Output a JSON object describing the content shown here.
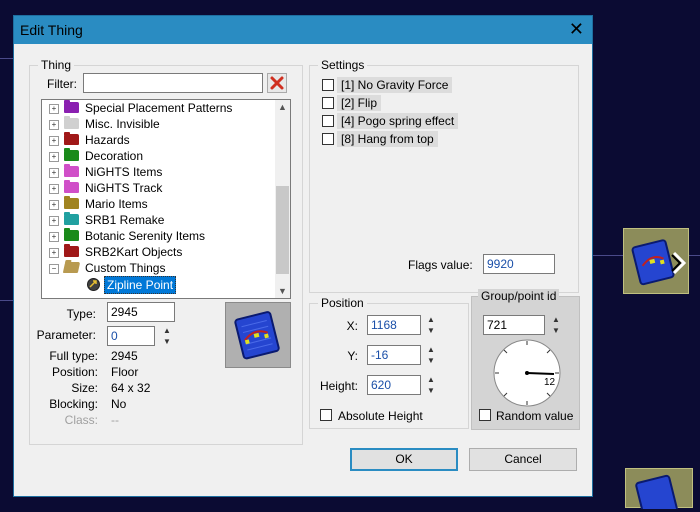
{
  "dialog": {
    "title": "Edit Thing",
    "close_symbol": "✕"
  },
  "thing": {
    "group_label": "Thing",
    "filter_label": "Filter:",
    "filter_value": "",
    "tree": [
      {
        "label": "Special Placement Patterns",
        "color": "#8a1fb0"
      },
      {
        "label": "Misc. Invisible",
        "color": "#d0d0d0"
      },
      {
        "label": "Hazards",
        "color": "#a01818"
      },
      {
        "label": "Decoration",
        "color": "#1a8a1a"
      },
      {
        "label": "NiGHTS Items",
        "color": "#d04fc8"
      },
      {
        "label": "NiGHTS Track",
        "color": "#d04fc8"
      },
      {
        "label": "Mario Items",
        "color": "#a08420"
      },
      {
        "label": "SRB1 Remake",
        "color": "#20a0a0"
      },
      {
        "label": "Botanic Serenity Items",
        "color": "#1a8a1a"
      },
      {
        "label": "SRB2Kart Objects",
        "color": "#a01818"
      },
      {
        "label": "Custom Things",
        "color": "#b89a50"
      },
      {
        "label": "Zipline Point",
        "color": "#2a8cc2"
      }
    ],
    "type_label": "Type:",
    "type_value": "2945",
    "parameter_label": "Parameter:",
    "parameter_value": "0",
    "fulltype_label": "Full type:",
    "fulltype_value": "2945",
    "position_label": "Position:",
    "position_value": "Floor",
    "size_label": "Size:",
    "size_value": "64 x 32",
    "blocking_label": "Blocking:",
    "blocking_value": "No",
    "class_label": "Class:",
    "class_value": "--"
  },
  "settings": {
    "group_label": "Settings",
    "flags": [
      {
        "label": "[1] No Gravity Force",
        "checked": false
      },
      {
        "label": "[2] Flip",
        "checked": false
      },
      {
        "label": "[4] Pogo spring effect",
        "checked": false
      },
      {
        "label": "[8] Hang from top",
        "checked": false
      }
    ],
    "flags_value_label": "Flags value:",
    "flags_value": "9920"
  },
  "position": {
    "group_label": "Position",
    "x_label": "X:",
    "x_value": "1168",
    "y_label": "Y:",
    "y_value": "-16",
    "height_label": "Height:",
    "height_value": "620",
    "absolute_height_label": "Absolute Height"
  },
  "group": {
    "group_label": "Group/point id",
    "id_value": "721",
    "dial_reading": "1​2",
    "random_label": "Random value"
  },
  "buttons": {
    "ok": "OK",
    "cancel": "Cancel"
  }
}
